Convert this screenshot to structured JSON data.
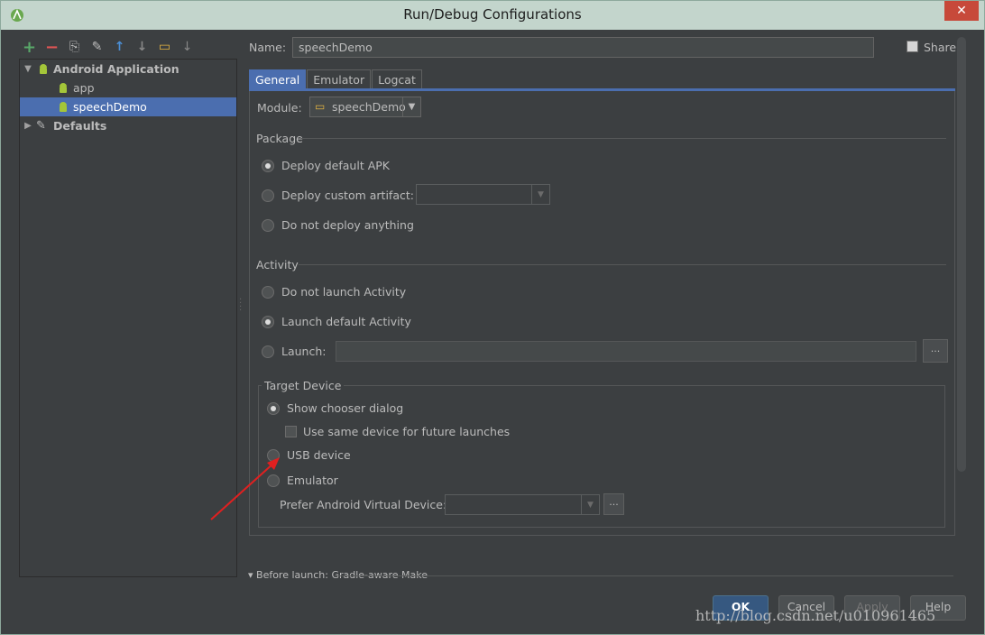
{
  "window": {
    "title": "Run/Debug Configurations",
    "close_glyph": "✕"
  },
  "toolbar": {
    "buttons": [
      {
        "name": "add-icon",
        "glyph": "+",
        "color": "#59a869"
      },
      {
        "name": "remove-icon",
        "glyph": "−",
        "color": "#e05555"
      },
      {
        "name": "copy-icon",
        "glyph": "⎘",
        "color": "#bbbbbb"
      },
      {
        "name": "wrench-icon",
        "glyph": "✎",
        "color": "#bbbbbb"
      },
      {
        "name": "move-up-icon",
        "glyph": "↑",
        "color": "#4b8fd6"
      },
      {
        "name": "move-down-icon",
        "glyph": "↓",
        "color": "#888888"
      },
      {
        "name": "folder-icon",
        "glyph": "▭",
        "color": "#e3b341"
      },
      {
        "name": "sort-icon",
        "glyph": "↓",
        "color": "#888888"
      }
    ]
  },
  "tree": {
    "android_application": "Android Application",
    "app": "app",
    "speechdemo": "speechDemo",
    "defaults": "Defaults"
  },
  "name": {
    "label": "Name:",
    "value": "speechDemo"
  },
  "share": {
    "label": "Share"
  },
  "tabs": [
    "General",
    "Emulator",
    "Logcat"
  ],
  "module": {
    "label": "Module:",
    "value": "speechDemo"
  },
  "package": {
    "title": "Package",
    "deploy_default": "Deploy default APK",
    "deploy_custom": "Deploy custom artifact:",
    "do_not_deploy": "Do not deploy anything"
  },
  "activity": {
    "title": "Activity",
    "do_not_launch": "Do not launch Activity",
    "launch_default": "Launch default Activity",
    "launch": "Launch:",
    "browse": "..."
  },
  "target_device": {
    "title": "Target Device",
    "show_chooser": "Show chooser dialog",
    "same_device": "Use same device for future launches",
    "usb_device": "USB device",
    "emulator": "Emulator",
    "prefer_avd": "Prefer Android Virtual Device:",
    "browse": "..."
  },
  "before_launch": "▾ Before launch: Gradle-aware Make",
  "buttons": {
    "ok": "OK",
    "cancel": "Cancel",
    "apply": "Apply",
    "help": "Help"
  },
  "watermark": "http://blog.csdn.net/u010961465",
  "colors": {
    "selection": "#4b6eaf",
    "annotation_arrow": "#e02020"
  }
}
